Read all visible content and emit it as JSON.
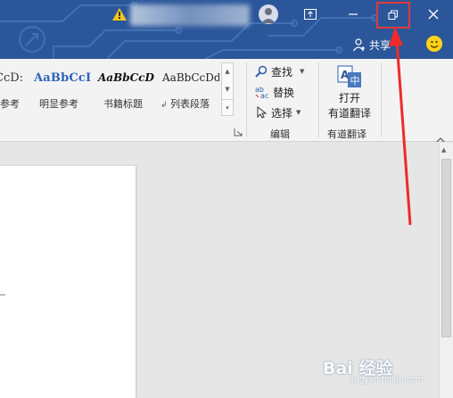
{
  "titlebar": {
    "share_label": "共享",
    "colors": {
      "bar": "#2b579a",
      "highlight": "#e23a3a"
    }
  },
  "ribbon": {
    "styles": [
      {
        "sample": "CcD:",
        "label": "参考"
      },
      {
        "sample": "AaBbCcI",
        "label": "明显参考"
      },
      {
        "sample": "AaBbCcD",
        "label": "书籍标题"
      },
      {
        "sample": "AaBbCcDd",
        "label": "列表段落"
      }
    ],
    "editing": {
      "find_label": "查找",
      "replace_label": "替换",
      "select_label": "选择",
      "group_label": "编辑"
    },
    "translate": {
      "button_line1": "打开",
      "button_line2": "有道翻译",
      "group_label": "有道翻译"
    }
  },
  "watermark": {
    "main": "Bai 经验",
    "sub": "jingyan.baidu.com"
  }
}
